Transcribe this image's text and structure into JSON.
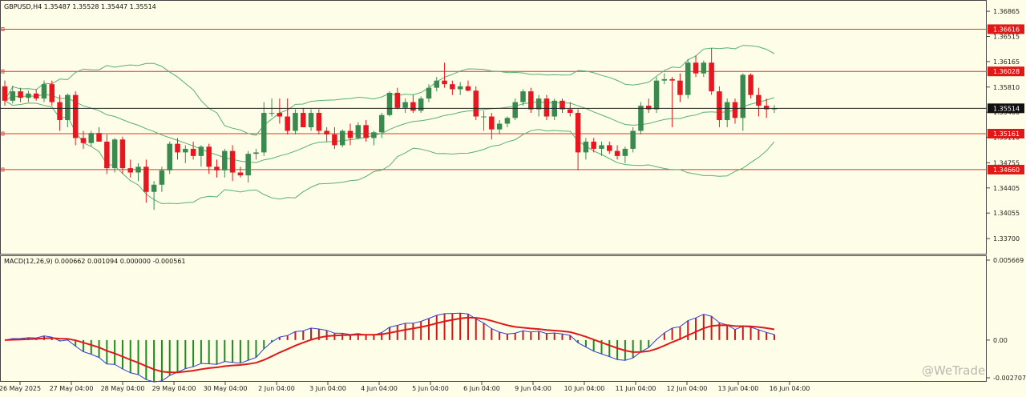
{
  "header": {
    "price_info": "GBPUSD,H4  1.35487 1.35528 1.35447 1.35514",
    "macd_info": "MACD(12,26,9) 0.000662 0.001094 0.000000 -0.000561"
  },
  "watermark": "@WeTrade",
  "colors": {
    "background": "#fefde8",
    "bull_candle": "#3a8a4f",
    "bear_candle": "#e8161e",
    "bollinger": "#57b070",
    "level_line": "#e63030",
    "current_price_line": "#222222",
    "macd_main": "#2f3fd6",
    "macd_signal": "#dd1a1a",
    "hist_positive": "#cc1a1a",
    "hist_negative": "#1f8a1f"
  },
  "chart_data": [
    {
      "type": "candlestick",
      "symbol": "GBPUSD",
      "timeframe": "H4",
      "ylim": [
        1.335,
        1.37
      ],
      "y_ticks": [
        "1.36865",
        "1.36515",
        "1.36165",
        "1.35810",
        "1.35460",
        "1.35110",
        "1.34755",
        "1.34405",
        "1.34055",
        "1.33700"
      ],
      "x_ticks": [
        "26 May 2025",
        "27 May 04:00",
        "28 May 04:00",
        "29 May 04:00",
        "30 May 04:00",
        "2 Jun 04:00",
        "3 Jun 04:00",
        "4 Jun 04:00",
        "5 Jun 04:00",
        "6 Jun 04:00",
        "9 Jun 04:00",
        "10 Jun 04:00",
        "11 Jun 04:00",
        "12 Jun 04:00",
        "13 Jun 04:00",
        "16 Jun 04:00"
      ],
      "levels": [
        {
          "value": 1.36616,
          "label": "1.36616"
        },
        {
          "value": 1.36028,
          "label": "1.36028"
        },
        {
          "value": 1.35161,
          "label": "1.35161"
        },
        {
          "value": 1.3466,
          "label": "1.34660"
        }
      ],
      "current_price": {
        "value": 1.35514,
        "label": "1.35514"
      },
      "candles": [
        [
          1.3582,
          1.359,
          1.3555,
          1.3562
        ],
        [
          1.3562,
          1.3583,
          1.3558,
          1.3575
        ],
        [
          1.3575,
          1.358,
          1.356,
          1.3566
        ],
        [
          1.3566,
          1.3576,
          1.356,
          1.3572
        ],
        [
          1.3572,
          1.3578,
          1.3562,
          1.3565
        ],
        [
          1.3565,
          1.359,
          1.356,
          1.3585
        ],
        [
          1.3585,
          1.359,
          1.3555,
          1.356
        ],
        [
          1.356,
          1.357,
          1.352,
          1.3535
        ],
        [
          1.3535,
          1.3572,
          1.3525,
          1.357
        ],
        [
          1.357,
          1.3575,
          1.35,
          1.351
        ],
        [
          1.351,
          1.352,
          1.3495,
          1.3503
        ],
        [
          1.3503,
          1.352,
          1.3498,
          1.3517
        ],
        [
          1.3517,
          1.3525,
          1.3505,
          1.3505
        ],
        [
          1.3505,
          1.3515,
          1.346,
          1.3468
        ],
        [
          1.3468,
          1.351,
          1.3462,
          1.3508
        ],
        [
          1.3508,
          1.3512,
          1.346,
          1.3468
        ],
        [
          1.3468,
          1.348,
          1.3455,
          1.3462
        ],
        [
          1.3462,
          1.3475,
          1.345,
          1.347
        ],
        [
          1.347,
          1.348,
          1.342,
          1.3435
        ],
        [
          1.3435,
          1.345,
          1.341,
          1.3445
        ],
        [
          1.3445,
          1.347,
          1.3435,
          1.3465
        ],
        [
          1.3465,
          1.3505,
          1.346,
          1.3502
        ],
        [
          1.3502,
          1.351,
          1.348,
          1.349
        ],
        [
          1.349,
          1.35,
          1.3475,
          1.3495
        ],
        [
          1.3495,
          1.3505,
          1.348,
          1.3485
        ],
        [
          1.3485,
          1.35,
          1.347,
          1.3498
        ],
        [
          1.3498,
          1.3502,
          1.346,
          1.347
        ],
        [
          1.347,
          1.348,
          1.3455,
          1.3465
        ],
        [
          1.3465,
          1.3495,
          1.3455,
          1.3492
        ],
        [
          1.3492,
          1.35,
          1.345,
          1.3462
        ],
        [
          1.3462,
          1.347,
          1.3455,
          1.3458
        ],
        [
          1.3458,
          1.3492,
          1.3448,
          1.3488
        ],
        [
          1.3488,
          1.3495,
          1.348,
          1.349
        ],
        [
          1.349,
          1.356,
          1.3485,
          1.3545
        ],
        [
          1.3545,
          1.3565,
          1.354,
          1.3545
        ],
        [
          1.3545,
          1.3565,
          1.353,
          1.354
        ],
        [
          1.354,
          1.3565,
          1.3515,
          1.352
        ],
        [
          1.352,
          1.355,
          1.3515,
          1.3545
        ],
        [
          1.3545,
          1.3552,
          1.3525,
          1.3525
        ],
        [
          1.3525,
          1.355,
          1.352,
          1.3545
        ],
        [
          1.3545,
          1.355,
          1.3515,
          1.352
        ],
        [
          1.352,
          1.3525,
          1.3505,
          1.3515
        ],
        [
          1.3515,
          1.3525,
          1.3495,
          1.35
        ],
        [
          1.35,
          1.3522,
          1.3497,
          1.352
        ],
        [
          1.352,
          1.353,
          1.35,
          1.351
        ],
        [
          1.351,
          1.3532,
          1.3508,
          1.3528
        ],
        [
          1.3528,
          1.3535,
          1.3505,
          1.351
        ],
        [
          1.351,
          1.352,
          1.35,
          1.3518
        ],
        [
          1.3518,
          1.3545,
          1.351,
          1.3542
        ],
        [
          1.3542,
          1.3575,
          1.354,
          1.3573
        ],
        [
          1.3573,
          1.358,
          1.355,
          1.3552
        ],
        [
          1.3552,
          1.3565,
          1.3545,
          1.356
        ],
        [
          1.356,
          1.357,
          1.3545,
          1.3548
        ],
        [
          1.3548,
          1.3568,
          1.3545,
          1.3565
        ],
        [
          1.3565,
          1.3585,
          1.356,
          1.358
        ],
        [
          1.358,
          1.3595,
          1.3575,
          1.359
        ],
        [
          1.359,
          1.3615,
          1.358,
          1.3585
        ],
        [
          1.3585,
          1.359,
          1.357,
          1.3578
        ],
        [
          1.3578,
          1.3588,
          1.357,
          1.3582
        ],
        [
          1.3582,
          1.359,
          1.3575,
          1.3576
        ],
        [
          1.3576,
          1.3582,
          1.3535,
          1.354
        ],
        [
          1.354,
          1.3548,
          1.352,
          1.354
        ],
        [
          1.354,
          1.3545,
          1.3508,
          1.3522
        ],
        [
          1.3522,
          1.3535,
          1.3515,
          1.353
        ],
        [
          1.353,
          1.354,
          1.3525,
          1.3538
        ],
        [
          1.3538,
          1.3565,
          1.3535,
          1.356
        ],
        [
          1.356,
          1.3578,
          1.3555,
          1.3575
        ],
        [
          1.3575,
          1.358,
          1.3545,
          1.355
        ],
        [
          1.355,
          1.357,
          1.354,
          1.3565
        ],
        [
          1.3565,
          1.357,
          1.3535,
          1.354
        ],
        [
          1.354,
          1.3565,
          1.3535,
          1.3562
        ],
        [
          1.3562,
          1.3565,
          1.3545,
          1.355
        ],
        [
          1.355,
          1.356,
          1.354,
          1.3545
        ],
        [
          1.3545,
          1.355,
          1.3465,
          1.349
        ],
        [
          1.349,
          1.351,
          1.348,
          1.3505
        ],
        [
          1.3505,
          1.351,
          1.349,
          1.3495
        ],
        [
          1.3495,
          1.3505,
          1.3485,
          1.35
        ],
        [
          1.35,
          1.3505,
          1.3488,
          1.3492
        ],
        [
          1.3492,
          1.35,
          1.348,
          1.3485
        ],
        [
          1.3485,
          1.3498,
          1.3475,
          1.3495
        ],
        [
          1.3495,
          1.3525,
          1.349,
          1.352
        ],
        [
          1.352,
          1.356,
          1.3515,
          1.3555
        ],
        [
          1.3555,
          1.3565,
          1.3545,
          1.355
        ],
        [
          1.355,
          1.3595,
          1.3545,
          1.359
        ],
        [
          1.359,
          1.36,
          1.3585,
          1.3592
        ],
        [
          1.3592,
          1.3595,
          1.3525,
          1.359
        ],
        [
          1.359,
          1.36,
          1.356,
          1.357
        ],
        [
          1.357,
          1.362,
          1.3565,
          1.3615
        ],
        [
          1.3615,
          1.3625,
          1.3595,
          1.36
        ],
        [
          1.36,
          1.3618,
          1.3595,
          1.3615
        ],
        [
          1.3615,
          1.3635,
          1.357,
          1.3575
        ],
        [
          1.3575,
          1.3582,
          1.3525,
          1.3535
        ],
        [
          1.3535,
          1.3565,
          1.3525,
          1.356
        ],
        [
          1.356,
          1.3565,
          1.353,
          1.3538
        ],
        [
          1.3538,
          1.36,
          1.352,
          1.3598
        ],
        [
          1.3598,
          1.36,
          1.3565,
          1.357
        ],
        [
          1.357,
          1.358,
          1.354,
          1.3555
        ],
        [
          1.3555,
          1.3565,
          1.3538,
          1.355
        ],
        [
          1.355,
          1.3556,
          1.3545,
          1.35514
        ]
      ]
    },
    {
      "type": "line",
      "name": "MACD(12,26,9)",
      "ylim": [
        -0.0028,
        0.0058
      ],
      "y_ticks": [
        "0.005669",
        "0.00",
        "-0.002707"
      ],
      "zero_label": "0.00"
    }
  ]
}
